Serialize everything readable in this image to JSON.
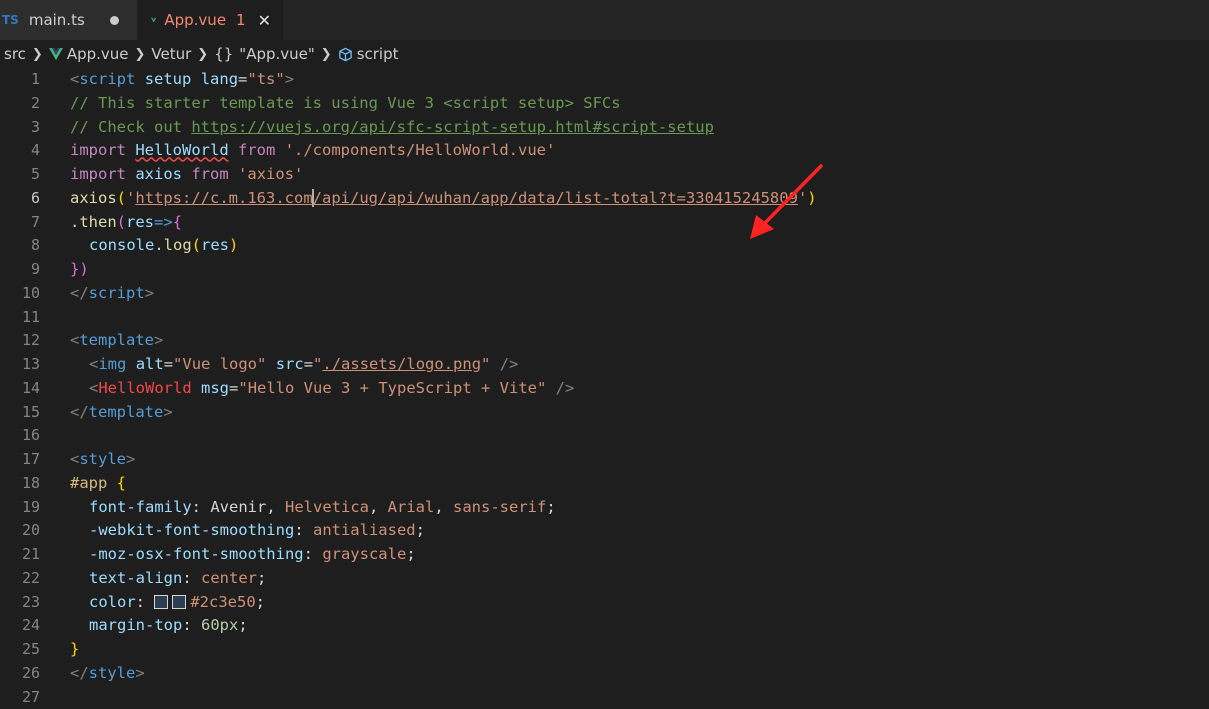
{
  "tabs": [
    {
      "icon": "TS",
      "label": "main.ts",
      "state": "unsaved"
    },
    {
      "label": "App.vue",
      "problems": "1"
    }
  ],
  "breadcrumb": {
    "items": [
      "src",
      "App.vue",
      "Vetur",
      "\"App.vue\"",
      "script"
    ],
    "braces": "{}"
  },
  "colors": {
    "accent_vue": "#41b883",
    "error": "#f48771",
    "swatch": "#2c3e50",
    "arrow": "#ff2222"
  },
  "editor": {
    "line_numbers": [
      "1",
      "2",
      "3",
      "4",
      "5",
      "6",
      "7",
      "8",
      "9",
      "10",
      "11",
      "12",
      "13",
      "14",
      "15",
      "16",
      "17",
      "18",
      "19",
      "20",
      "21",
      "22",
      "23",
      "24",
      "25",
      "26",
      "27"
    ],
    "active_line": "6",
    "code": {
      "l1": {
        "lt": "<",
        "tag": "script",
        "a1": "setup",
        "a2": "lang",
        "eq": "=",
        "v": "\"ts\"",
        "gt": ">"
      },
      "l2": "// This starter template is using Vue 3 <script setup> SFCs",
      "l3": {
        "prefix": "// Check out ",
        "link": "https://vuejs.org/api/sfc-script-setup.html#script-setup"
      },
      "l4": {
        "kw": "import",
        "id": "HelloWorld",
        "from": "from",
        "src": "'./components/HelloWorld.vue'"
      },
      "l5": {
        "kw": "import",
        "id": "axios",
        "from": "from",
        "src": "'axios'"
      },
      "l6": {
        "fn": "axios",
        "open": "(",
        "q": "'",
        "url_a": "https://c.m.163.com",
        "url_b": "/api/ug/api/wuhan/app/data/list-total?t=330415245809",
        "q2": "'",
        "close": ")"
      },
      "l7": {
        "dot": ".",
        "fn": "then",
        "p": "(",
        "arg": "res",
        "arrow": "=>",
        "brace": "{"
      },
      "l8": {
        "obj": "console",
        "dot": ".",
        "fn": "log",
        "p": "(",
        "arg": "res",
        "pc": ")"
      },
      "l9": {
        "brace": "}",
        "p": ")"
      },
      "l10": {
        "lt": "</",
        "tag": "script",
        "gt": ">"
      },
      "l12": {
        "lt": "<",
        "tag": "template",
        "gt": ">"
      },
      "l13": {
        "lt": "<",
        "tag": "img",
        "a1": "alt",
        "v1": "\"Vue logo\"",
        "a2": "src",
        "q": "\"",
        "v2": "./assets/logo.png",
        "q2": "\"",
        "end": " />"
      },
      "l14": {
        "lt": "<",
        "tag": "HelloWorld",
        "a1": "msg",
        "v1": "\"Hello Vue 3 + TypeScript + Vite\"",
        "end": " />"
      },
      "l15": {
        "lt": "</",
        "tag": "template",
        "gt": ">"
      },
      "l17": {
        "lt": "<",
        "tag": "style",
        "gt": ">"
      },
      "l18": {
        "sel": "#app",
        "brace": "{"
      },
      "l19": {
        "prop": "font-family",
        "v1": "Avenir",
        "v2": "Helvetica",
        "v3": "Arial",
        "v4": "sans-serif"
      },
      "l20": {
        "prop": "-webkit-font-smoothing",
        "v": "antialiased"
      },
      "l21": {
        "prop": "-moz-osx-font-smoothing",
        "v": "grayscale"
      },
      "l22": {
        "prop": "text-align",
        "v": "center"
      },
      "l23": {
        "prop": "color",
        "v": "#2c3e50"
      },
      "l24": {
        "prop": "margin-top",
        "v": "60px"
      },
      "l25": {
        "brace": "}"
      },
      "l26": {
        "lt": "</",
        "tag": "style",
        "gt": ">"
      }
    }
  }
}
